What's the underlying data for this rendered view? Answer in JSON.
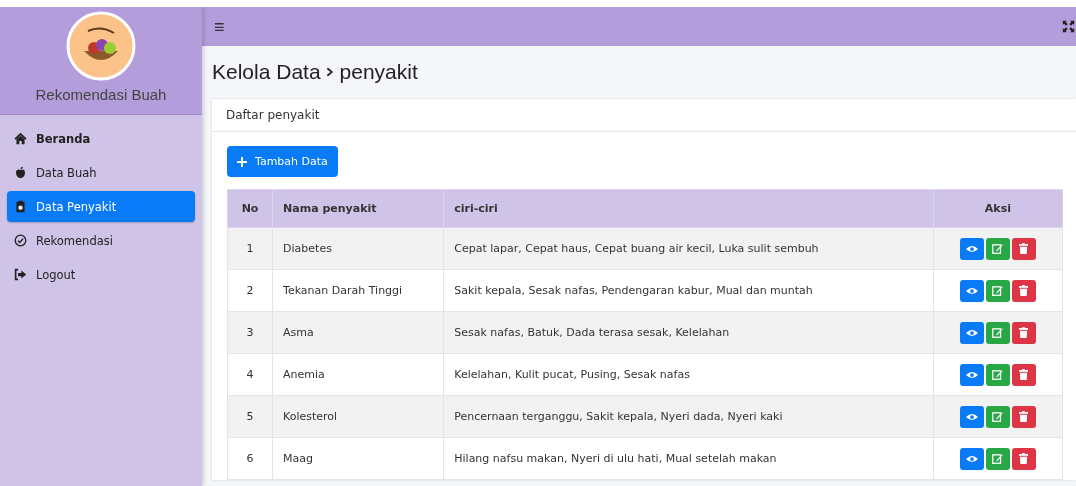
{
  "sidebar": {
    "brand": "Rekomendasi Buah",
    "items": [
      {
        "label": "Beranda",
        "kind": "home",
        "bold": true,
        "selected": false
      },
      {
        "label": "Data Buah",
        "kind": "apple",
        "bold": false,
        "selected": false
      },
      {
        "label": "Data Penyakit",
        "kind": "clipboard",
        "bold": false,
        "selected": true
      },
      {
        "label": "Rekomendasi",
        "kind": "check",
        "bold": false,
        "selected": false
      },
      {
        "label": "Logout",
        "kind": "logout",
        "bold": false,
        "selected": false
      }
    ]
  },
  "topbar": {
    "menu_icon": "≡"
  },
  "page_title": {
    "section": "Kelola Data",
    "current": "penyakit"
  },
  "card": {
    "title": "Daftar penyakit",
    "add_button": "Tambah Data"
  },
  "table": {
    "columns": [
      "No",
      "Nama penyakit",
      "ciri-ciri",
      "Aksi"
    ],
    "actions": [
      {
        "kind": "view"
      },
      {
        "kind": "edit"
      },
      {
        "kind": "delete"
      }
    ],
    "rows": [
      {
        "no": "1",
        "name": "Diabetes",
        "symptoms": "Cepat lapar, Cepat haus, Cepat buang air kecil, Luka sulit sembuh"
      },
      {
        "no": "2",
        "name": "Tekanan Darah Tinggi",
        "symptoms": "Sakit kepala, Sesak nafas, Pendengaran kabur, Mual dan muntah"
      },
      {
        "no": "3",
        "name": "Asma",
        "symptoms": "Sesak nafas, Batuk, Dada terasa sesak, Kelelahan"
      },
      {
        "no": "4",
        "name": "Anemia",
        "symptoms": "Kelelahan, Kulit pucat, Pusing, Sesak nafas"
      },
      {
        "no": "5",
        "name": "Kolesterol",
        "symptoms": "Pencernaan terganggu, Sakit kepala, Nyeri dada, Nyeri kaki"
      },
      {
        "no": "6",
        "name": "Maag",
        "symptoms": "Hilang nafsu makan, Nyeri di ulu hati, Mual setelah makan"
      }
    ]
  }
}
